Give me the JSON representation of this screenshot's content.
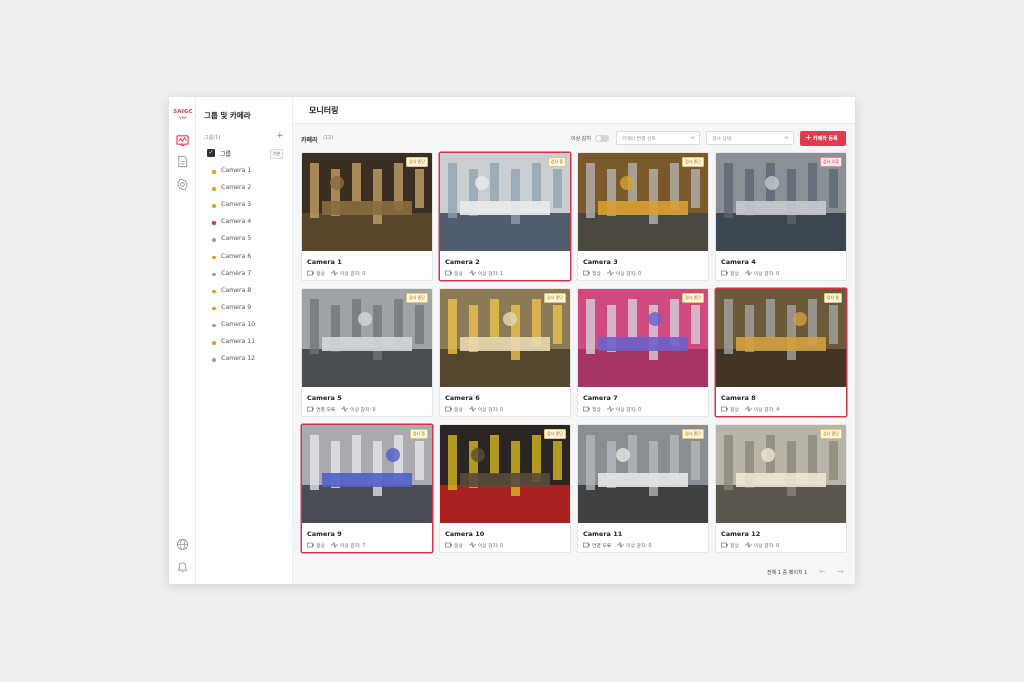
{
  "brand": {
    "name": "SAIGC",
    "sub": "VMS"
  },
  "rail": {
    "icons": [
      "monitor-icon",
      "document-icon",
      "settings-icon",
      "globe-icon",
      "bell-icon"
    ]
  },
  "sidebar": {
    "title": "그룹 및 카메라",
    "section_label": "그룹(1)",
    "add_label": "+",
    "group": {
      "check": "✓",
      "label": "그룹",
      "badge": "기본"
    },
    "cameras": [
      {
        "name": "Camera 1",
        "status": "ok"
      },
      {
        "name": "Camera 2",
        "status": "ok"
      },
      {
        "name": "Camera 3",
        "status": "ok"
      },
      {
        "name": "Camera 4",
        "status": "error"
      },
      {
        "name": "Camera 5",
        "status": "off"
      },
      {
        "name": "Camera 6",
        "status": "ok"
      },
      {
        "name": "Camera 7",
        "status": "off"
      },
      {
        "name": "Camera 8",
        "status": "ok"
      },
      {
        "name": "Camera 9",
        "status": "ok"
      },
      {
        "name": "Camera 10",
        "status": "off"
      },
      {
        "name": "Camera 11",
        "status": "ok"
      },
      {
        "name": "Camera 12",
        "status": "off"
      }
    ]
  },
  "header": {
    "title": "모니터링"
  },
  "toolbar": {
    "label": "카메라",
    "count": "(12)",
    "anomaly_label": "이상 감지",
    "anomaly_on": false,
    "connection_select": "카메라 연결 선호",
    "status_select": "검사 상태",
    "add_plus": "+",
    "add_label": "카메라 등록"
  },
  "cards": [
    {
      "name": "Camera 1",
      "badge": "검사 중단",
      "badge_type": "yellow",
      "conn": "정상",
      "anomaly": "이상 감지: 0",
      "alert": false
    },
    {
      "name": "Camera 2",
      "badge": "검사 중",
      "badge_type": "yellow",
      "conn": "정상",
      "anomaly": "이상 감지: 1",
      "alert": true
    },
    {
      "name": "Camera 3",
      "badge": "검사 중단",
      "badge_type": "yellow",
      "conn": "정상",
      "anomaly": "이상 감지: 0",
      "alert": false
    },
    {
      "name": "Camera 4",
      "badge": "검사 오류",
      "badge_type": "red",
      "conn": "정상",
      "anomaly": "이상 감지: 0",
      "alert": false
    },
    {
      "name": "Camera 5",
      "badge": "검사 중단",
      "badge_type": "yellow",
      "conn": "연결 오류",
      "anomaly": "이상 감지: 0",
      "alert": false
    },
    {
      "name": "Camera 6",
      "badge": "검사 중단",
      "badge_type": "yellow",
      "conn": "정상",
      "anomaly": "이상 감지: 0",
      "alert": false
    },
    {
      "name": "Camera 7",
      "badge": "검사 중단",
      "badge_type": "yellow",
      "conn": "정상",
      "anomaly": "이상 감지: 0",
      "alert": false
    },
    {
      "name": "Camera 8",
      "badge": "검사 중",
      "badge_type": "yellow",
      "conn": "정상",
      "anomaly": "이상 감지: 4",
      "alert": true
    },
    {
      "name": "Camera 9",
      "badge": "검사 중",
      "badge_type": "yellow",
      "conn": "정상",
      "anomaly": "이상 감지: 7",
      "alert": true
    },
    {
      "name": "Camera 10",
      "badge": "검사 중단",
      "badge_type": "yellow",
      "conn": "정상",
      "anomaly": "이상 감지: 0",
      "alert": false
    },
    {
      "name": "Camera 11",
      "badge": "검사 중단",
      "badge_type": "yellow",
      "conn": "연결 오류",
      "anomaly": "이상 감지: 0",
      "alert": false
    },
    {
      "name": "Camera 12",
      "badge": "검사 중단",
      "badge_type": "yellow",
      "conn": "정상",
      "anomaly": "이상 감지: 0",
      "alert": false
    }
  ],
  "pager": {
    "text": "전체 1 중 페이지 1",
    "prev": "←",
    "next": "→"
  },
  "colors": {
    "accent": "#e23a4f",
    "ok_dot": "#e0a020",
    "error_dot": "#d8334d",
    "off_dot": "#9aa0a6"
  }
}
